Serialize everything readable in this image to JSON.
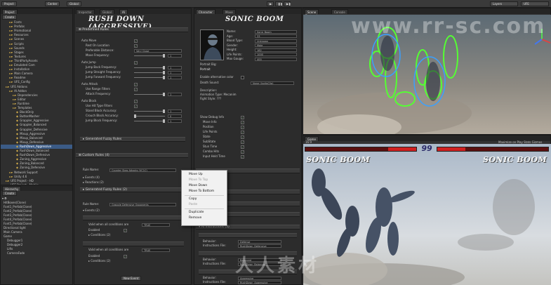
{
  "toolbar": {
    "project_tab": "Project",
    "create_btn": "Create",
    "center_btn": "Center",
    "global_btn": "Global",
    "layers_label": "Layers",
    "layout_label": "UFE"
  },
  "project": {
    "items": [
      {
        "label": "Fonts",
        "indent": 2
      },
      {
        "label": "Prefabs",
        "indent": 2
      },
      {
        "label": "Promotional",
        "indent": 2
      },
      {
        "label": "Resources",
        "indent": 2
      },
      {
        "label": "Scenes",
        "indent": 2
      },
      {
        "label": "Scripts",
        "indent": 2
      },
      {
        "label": "Sounds",
        "indent": 2
      },
      {
        "label": "Stages",
        "indent": 2
      },
      {
        "label": "Textures",
        "indent": 2
      },
      {
        "label": "ThirdPartyAssets",
        "indent": 2
      },
      {
        "label": "Emulated Cam",
        "indent": 2
      },
      {
        "label": "Installation",
        "indent": 2
      },
      {
        "label": "Main Camera",
        "indent": 2
      },
      {
        "label": "Readme",
        "indent": 2
      },
      {
        "label": "UFE_Config",
        "indent": 2
      },
      {
        "label": "UFE Addons",
        "indent": 1
      },
      {
        "label": "AI Addon",
        "indent": 2
      },
      {
        "label": "Dependencies",
        "indent": 3
      },
      {
        "label": "Editor",
        "indent": 3
      },
      {
        "label": "Runtime",
        "indent": 3
      },
      {
        "label": "Templates",
        "indent": 3
      },
      {
        "label": "BlockOnly",
        "indent": 4
      },
      {
        "label": "ButtonMasher",
        "indent": 4
      },
      {
        "label": "Grappler_Aggressive",
        "indent": 4
      },
      {
        "label": "Grappler_Balanced",
        "indent": 4
      },
      {
        "label": "Grappler_Defensive",
        "indent": 4
      },
      {
        "label": "Mixup_Aggressive",
        "indent": 4
      },
      {
        "label": "Mixup_Balanced",
        "indent": 4
      },
      {
        "label": "Mixup_Defensive",
        "indent": 4
      },
      {
        "label": "RushDown_Aggressive",
        "indent": 4,
        "selected": true
      },
      {
        "label": "RushDown_Balanced",
        "indent": 4
      },
      {
        "label": "RushDown_Defensive",
        "indent": 4
      },
      {
        "label": "Zoning_Aggressive",
        "indent": 4
      },
      {
        "label": "Zoning_Balanced",
        "indent": 4
      },
      {
        "label": "Zoning_Defensive",
        "indent": 4
      },
      {
        "label": "Network Support",
        "indent": 2
      },
      {
        "label": "Unity 4.6",
        "indent": 2
      },
      {
        "label": "UFE Project - HD",
        "indent": 1
      },
      {
        "label": "UFE Project - Mobile",
        "indent": 1
      }
    ]
  },
  "hierarchy": {
    "tab": "Hierarchy",
    "create_btn": "Create",
    "items": [
      {
        "label": "HitBoxes(Clone)",
        "indent": 0
      },
      {
        "label": "Font1_Prefab(Clone)",
        "indent": 0
      },
      {
        "label": "Font2_Prefab(Clone)",
        "indent": 0
      },
      {
        "label": "Font3_Prefab(Clone)",
        "indent": 0
      },
      {
        "label": "Font4_Prefab(Clone)",
        "indent": 0
      },
      {
        "label": "Font5_Prefab(Clone)",
        "indent": 0
      },
      {
        "label": "Directional light",
        "indent": 0
      },
      {
        "label": "Main Camera",
        "indent": 0
      },
      {
        "label": "Game",
        "indent": 0
      },
      {
        "label": "Debugger1",
        "indent": 1
      },
      {
        "label": "Debugger2",
        "indent": 1
      },
      {
        "label": "Lifts",
        "indent": 1
      },
      {
        "label": "CameraFade",
        "indent": 1
      }
    ]
  },
  "inspector": {
    "tabs": [
      "Inspector",
      "Global",
      "AI"
    ],
    "title": "RUSH DOWN (AGGRESSIVE)",
    "predefined_rules": "Predefined Rules",
    "fields": [
      {
        "label": "Auto Move",
        "type": "check",
        "on": true
      },
      {
        "label": "Rest On Location",
        "type": "check",
        "on": true
      },
      {
        "label": "Preferable Distance:",
        "type": "field",
        "value": "Very Close"
      },
      {
        "label": "Move Frequency:",
        "type": "slider",
        "value": "1"
      },
      {
        "label": "Auto Jump",
        "type": "check",
        "on": true
      },
      {
        "label": "Jump Back Frequency:",
        "type": "slider",
        "value": "1"
      },
      {
        "label": "Jump Straight Frequency:",
        "type": "slider",
        "value": "1"
      },
      {
        "label": "Jump Forward Frequency:",
        "type": "slider",
        "value": "1"
      },
      {
        "label": "Auto Attack",
        "type": "check",
        "on": true
      },
      {
        "label": "Use Range Filters",
        "type": "check",
        "on": true
      },
      {
        "label": "Attack Frequency:",
        "type": "slider",
        "value": "1"
      },
      {
        "label": "Auto Block",
        "type": "check",
        "on": true
      },
      {
        "label": "Use Hit Type Filters",
        "type": "check",
        "on": true
      },
      {
        "label": "Stand Block Accuracy:",
        "type": "slider",
        "value": "1"
      },
      {
        "label": "Crouch Block Accuracy:",
        "type": "slider",
        "value": "0"
      },
      {
        "label": "Jump Block Frequency:",
        "type": "slider",
        "value": "1"
      }
    ],
    "generated_fuzzy_rules": "Generated Fuzzy Rules",
    "custom_rules": "Custom Rules (4)",
    "rule_name_label": "Rule Name:",
    "rule1_name": "Counter Slow Attacks (VC1C)",
    "events_label": "Events (4)",
    "reactions_label": "Reactions (2)",
    "rule2_name": "Grapple Defensive Opponents",
    "events2_label": "Events (2)",
    "valid_label": "Valid when all conditions are",
    "valid_value": "TRUE",
    "enabled_label": "Enabled",
    "conditions_label": "Conditions (2)",
    "new_event": "New Event"
  },
  "context_menu": {
    "items": [
      {
        "label": "Move Up",
        "disabled": false
      },
      {
        "label": "Move To Top",
        "disabled": true
      },
      {
        "label": "Move Down",
        "disabled": false
      },
      {
        "label": "Move To Bottom",
        "disabled": false
      },
      {
        "sep": true
      },
      {
        "label": "Copy",
        "disabled": false
      },
      {
        "label": "Paste",
        "disabled": true
      },
      {
        "sep": true
      },
      {
        "label": "Duplicate",
        "disabled": false
      },
      {
        "label": "Remove",
        "disabled": false
      }
    ]
  },
  "character": {
    "tabs": [
      "Character",
      "Move"
    ],
    "title": "SONIC BOOM",
    "fields": [
      {
        "label": "Name:",
        "value": "Sonic Boom"
      },
      {
        "label": "Age:",
        "value": "33"
      },
      {
        "label": "Blood Type:",
        "value": "Unknown"
      },
      {
        "label": "Gender:",
        "value": "Male"
      },
      {
        "label": "Height:",
        "value": "182"
      },
      {
        "label": "Life Points:",
        "value": "1000"
      },
      {
        "label": "Max Gauge:",
        "value": "400"
      }
    ],
    "portrait_big": "Portrait Big:",
    "portrait_value": "Portrait",
    "alt_color": "Enable alternative color",
    "death_sound": "Death Sound:",
    "death_value": "None (AudioClip)",
    "description": "Description:",
    "desc_lines": [
      "Animation Type: Mecanim",
      "Fight Style: ???"
    ],
    "debug_info": "Show Debug Info",
    "debug_fields": [
      "Move Info",
      "Position",
      "Life Points",
      "State",
      "SubState",
      "Stun Time",
      "Combo Hits",
      "Input Held Time"
    ],
    "behavior_label": "Behavior:",
    "instructions_label": "Instructions File:",
    "behaviors": [
      {
        "behavior": "Defense",
        "file": "RushDown_Defensive"
      },
      {
        "behavior": "Balanced",
        "file": "RushDown_Balanced"
      },
      {
        "behavior": "Aggressive",
        "file": "RushDown_Aggressive"
      }
    ],
    "ai_instructions": "AI Instructions (3)"
  },
  "scene": {
    "tabs": [
      "Scene",
      "Console"
    ],
    "mode": "Textured"
  },
  "game": {
    "tab": "Game",
    "aspect": "16:9",
    "toolbar_right": "Maximize on Play   Stats   Gizmos",
    "p1_name": "SONIC BOOM",
    "p2_name": "SONIC BOOM",
    "timer": "99"
  },
  "watermark": {
    "url": "www.rr-sc.com",
    "cn": "人人素材"
  }
}
